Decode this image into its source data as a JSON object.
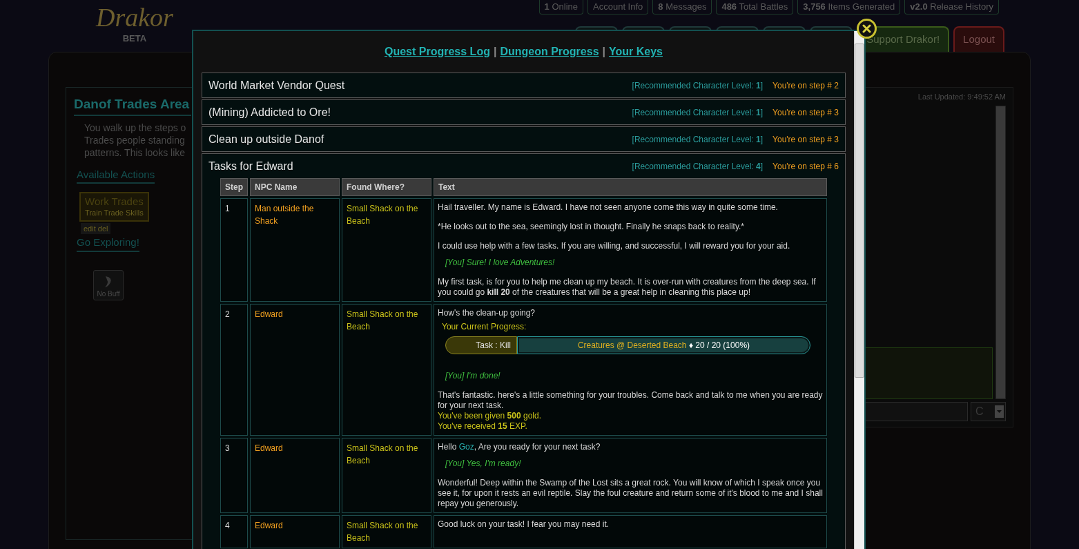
{
  "logo": {
    "text": "Drakor",
    "badge": "BETA"
  },
  "stats": [
    "**1** Online",
    "Account Info",
    "**8** Messages",
    "**486** Total Battles",
    "**3,756** Items Generated",
    "**v2.0** Release History"
  ],
  "nav": [
    {
      "kind": "plain"
    },
    {
      "kind": "plain"
    },
    {
      "kind": "plain"
    },
    {
      "kind": "plain"
    },
    {
      "kind": "plain"
    },
    {
      "kind": "plain"
    },
    {
      "label": "Support Drakor!",
      "kind": "support"
    },
    {
      "label": "Logout",
      "kind": "logout"
    }
  ],
  "location": {
    "title": "Danof Trades Area",
    "description": [
      "You walk up the steps o",
      "Trades people standing",
      "patterns. This looks like"
    ],
    "actions_heading": "Available Actions",
    "action": {
      "title": "Work Trades",
      "subtitle": "Train Trade Skills"
    },
    "edit_links": "edit del",
    "explore": "Go Exploring!",
    "buff": "No Buff"
  },
  "chat": {
    "last_updated": "Last Updated: 9:49:52 AM",
    "channel": "C"
  },
  "modal": {
    "links": [
      "Quest Progress Log",
      "Dungeon Progress",
      "Your Keys"
    ],
    "separator": "|",
    "quests": [
      {
        "title": "World Market Vendor Quest",
        "level": "[Recommended Character Level: **1**]",
        "step": "You're on step # 2",
        "expanded": false
      },
      {
        "title": "(Mining) Addicted to Ore!",
        "level": "[Recommended Character Level: **1**]",
        "step": "You're on step # 3",
        "expanded": false
      },
      {
        "title": "Clean up outside Danof",
        "level": "[Recommended Character Level: **1**]",
        "step": "You're on step # 3",
        "expanded": false
      },
      {
        "title": "Tasks for Edward",
        "level": "[Recommended Character Level: **4**]",
        "step": "You're on step # 6",
        "expanded": true,
        "table": {
          "columns": [
            "Step",
            "NPC Name",
            "Found Where?",
            "Text"
          ],
          "rows": [
            {
              "step": "1",
              "npc": "Man outside the Shack",
              "where": "Small Shack on the Beach",
              "lines": [
                {
                  "kind": "say",
                  "text": "Hail traveller. My name is Edward. I have not seen anyone come this way in quite some time."
                },
                {
                  "kind": "say",
                  "text": "*He looks out to the sea, seemingly lost in thought. Finally he snaps back to reality.*"
                },
                {
                  "kind": "say",
                  "text": "I could use help with a few tasks. If you are willing, and successful, I will reward you for your aid."
                },
                {
                  "kind": "reply",
                  "text": "[You] Sure! I love Adventures!"
                },
                {
                  "kind": "say",
                  "markup": "My first task, is for you to help me clean up my beach. It is over-run with creatures from the deep sea. If you could go **kill 20** of the creatures that will be a great help in cleaning this place up!"
                }
              ]
            },
            {
              "step": "2",
              "npc": "Edward",
              "where": "Small Shack on the Beach",
              "lines": [
                {
                  "kind": "say",
                  "text": "How's the clean-up going?"
                },
                {
                  "kind": "progress_label",
                  "text": "Your Current Progress:"
                },
                {
                  "kind": "progress",
                  "task": "Task : Kill",
                  "target": "Creatures @ Deserted Beach",
                  "count": "♦ 20 / 20 (100%)",
                  "level": 1
                },
                {
                  "kind": "reply",
                  "text": "[You] I'm done!"
                },
                {
                  "kind": "say",
                  "text": "That's fantastic. here's a little something for your troubles. Come back and talk to me when you are ready for your next task."
                },
                {
                  "kind": "reward",
                  "markup": "You've been given **500** gold."
                },
                {
                  "kind": "reward",
                  "markup": "You've received **15** EXP."
                }
              ]
            },
            {
              "step": "3",
              "npc": "Edward",
              "where": "Small Shack on the Beach",
              "lines": [
                {
                  "kind": "greeting",
                  "before": "Hello ",
                  "name": "Goz",
                  "after": ", Are you ready for your next task?"
                },
                {
                  "kind": "reply",
                  "text": "[You] Yes, I'm ready!"
                },
                {
                  "kind": "say",
                  "text": "Wonderful! Deep within the Swamp of the Lost sits a great rock. You will know of which I speak once you see it, for upon it rests an evil reptile. Slay the foul creature and return some of it's blood to me and I shall repay you generously."
                }
              ]
            },
            {
              "step": "4",
              "npc": "Edward",
              "where": "Small Shack on the Beach",
              "lines": [
                {
                  "kind": "say",
                  "text": "Good luck on your task! I fear you may need it."
                }
              ]
            }
          ]
        }
      }
    ]
  }
}
